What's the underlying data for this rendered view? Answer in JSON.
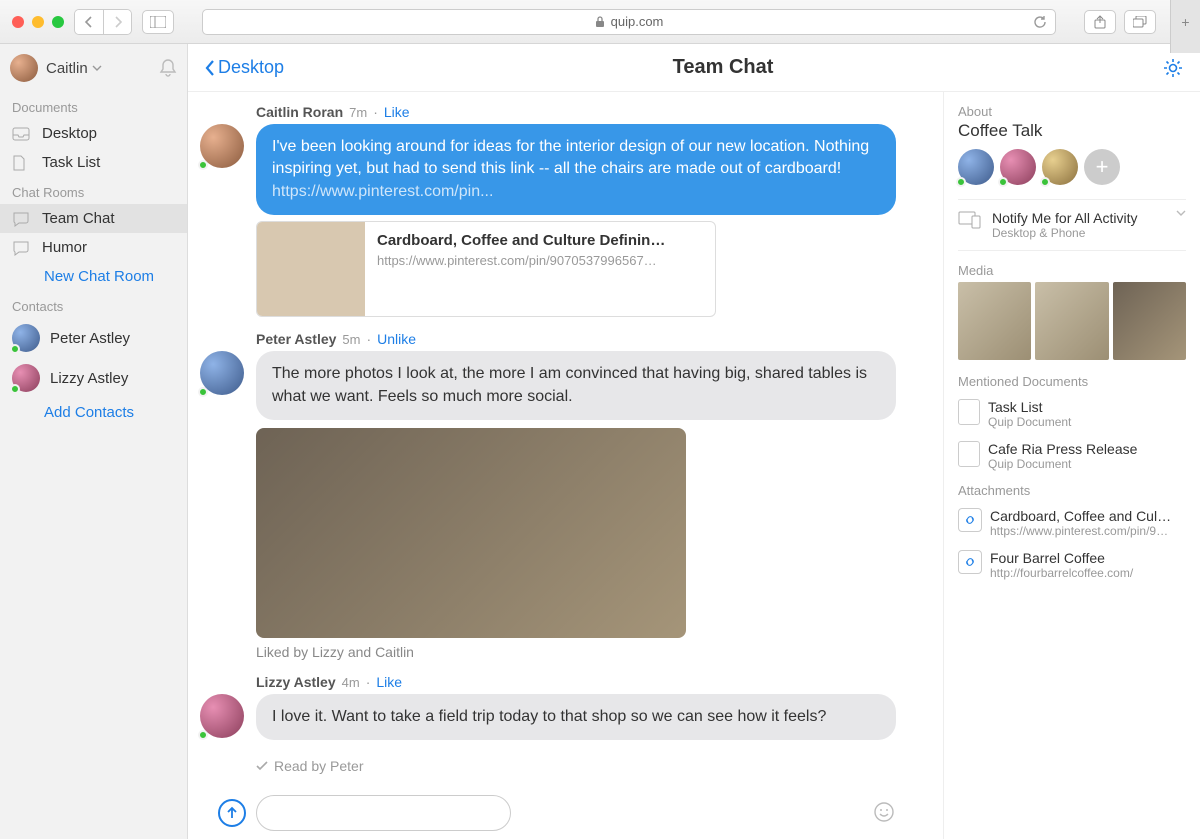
{
  "browser": {
    "url_host": "quip.com",
    "lock_icon": "lock-icon"
  },
  "sidebar": {
    "user_name": "Caitlin",
    "sections": {
      "documents_label": "Documents",
      "chatrooms_label": "Chat Rooms",
      "contacts_label": "Contacts"
    },
    "documents": [
      {
        "label": "Desktop"
      },
      {
        "label": "Task List"
      }
    ],
    "chatrooms": [
      {
        "label": "Team Chat",
        "active": true
      },
      {
        "label": "Humor"
      }
    ],
    "new_chat_room": "New Chat Room",
    "contacts": [
      {
        "label": "Peter Astley"
      },
      {
        "label": "Lizzy Astley"
      }
    ],
    "add_contacts": "Add Contacts"
  },
  "header": {
    "back_label": "Desktop",
    "title": "Team Chat"
  },
  "messages": [
    {
      "author": "Caitlin Roran",
      "time": "7m",
      "action": "Like",
      "bubble_color": "blue",
      "text": "I've been looking around for ideas for the interior design of our new location. Nothing inspiring yet, but had to send this link -- all the chairs are made out of cardboard! ",
      "link_text": "https://www.pinterest.com/pin...",
      "link_card": {
        "title": "Cardboard, Coffee and Culture Definin…",
        "url": "https://www.pinterest.com/pin/9070537996567…"
      }
    },
    {
      "author": "Peter Astley",
      "time": "5m",
      "action": "Unlike",
      "bubble_color": "gray",
      "text": "The more photos I look at, the more I am convinced that having big, shared tables is what we want. Feels so much more social.",
      "has_photo": true,
      "liked_by": "Liked by Lizzy and Caitlin"
    },
    {
      "author": "Lizzy Astley",
      "time": "4m",
      "action": "Like",
      "bubble_color": "gray",
      "text": "I love it. Want to take a field trip today to that shop so we can see how it feels?"
    }
  ],
  "read_receipt": "Read by Peter",
  "composer": {
    "placeholder": ""
  },
  "info": {
    "about_label": "About",
    "title": "Coffee Talk",
    "notify": {
      "title": "Notify Me for All Activity",
      "sub": "Desktop & Phone"
    },
    "media_label": "Media",
    "mentioned_label": "Mentioned Documents",
    "mentioned": [
      {
        "title": "Task List",
        "sub": "Quip Document"
      },
      {
        "title": "Cafe Ria Press Release",
        "sub": "Quip Document"
      }
    ],
    "attachments_label": "Attachments",
    "attachments": [
      {
        "title": "Cardboard, Coffee and Cul…",
        "sub": "https://www.pinterest.com/pin/9…"
      },
      {
        "title": "Four Barrel Coffee",
        "sub": "http://fourbarrelcoffee.com/"
      }
    ]
  }
}
